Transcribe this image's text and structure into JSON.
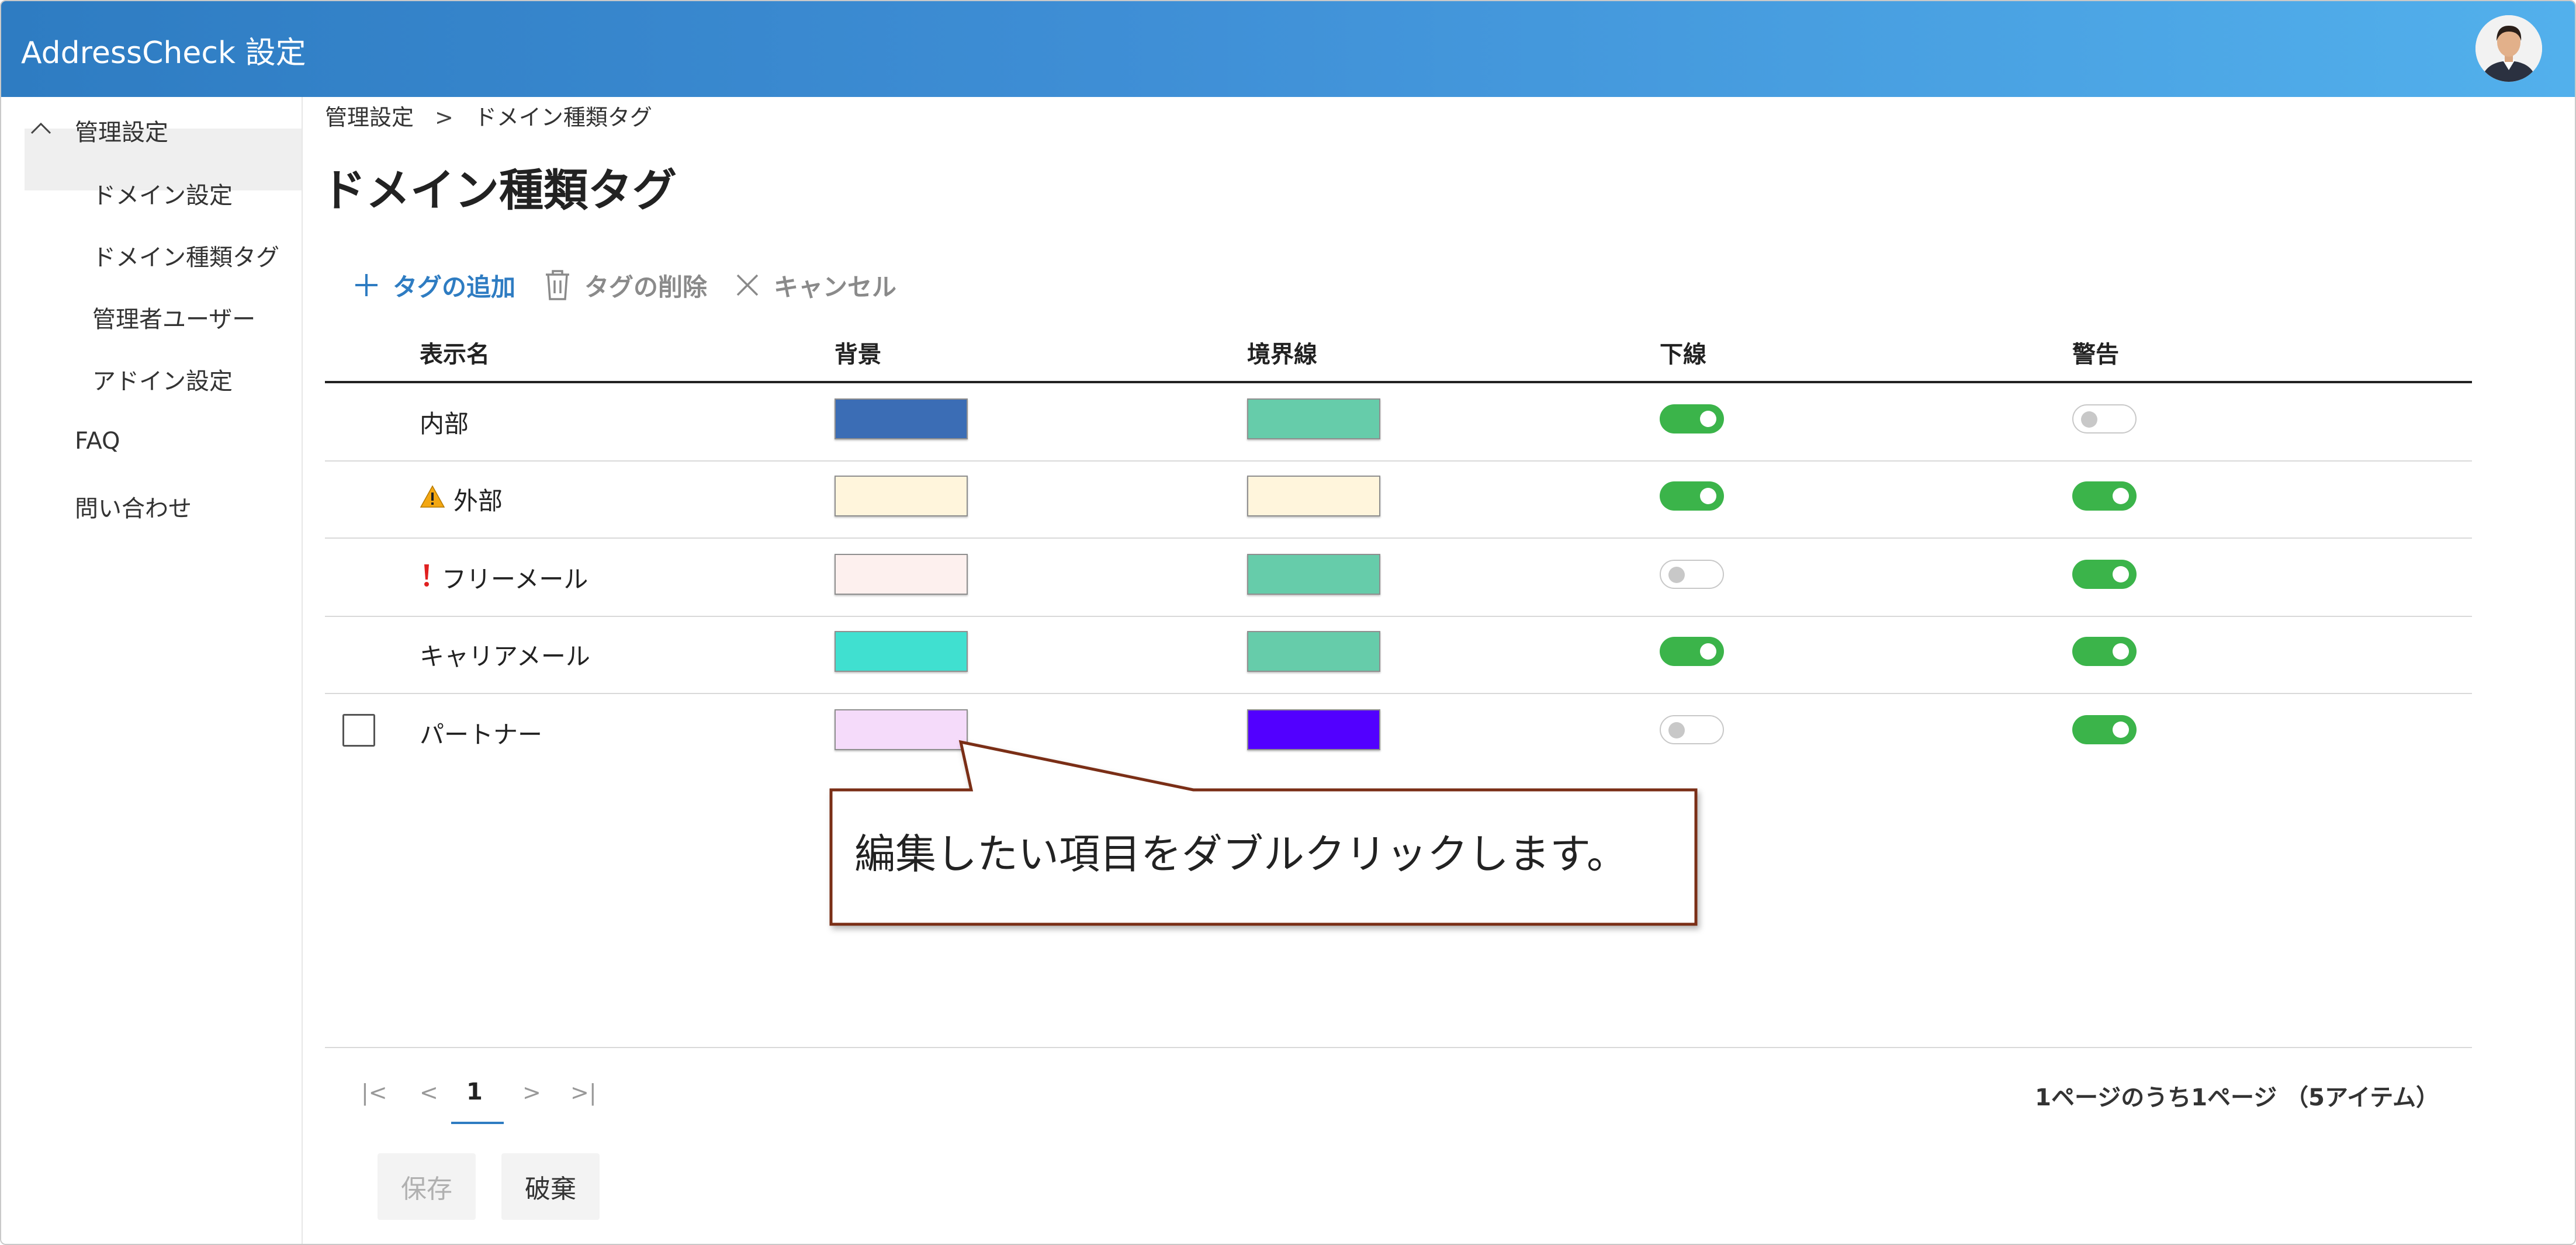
{
  "app": {
    "title": "AddressCheck 設定"
  },
  "sidebar": {
    "group_label": "管理設定",
    "items": [
      {
        "label": "ドメイン設定"
      },
      {
        "label": "ドメイン種類タグ",
        "selected": true
      },
      {
        "label": "管理者ユーザー"
      },
      {
        "label": "アドイン設定"
      }
    ],
    "faq": "FAQ",
    "contact": "問い合わせ"
  },
  "breadcrumb": {
    "parent": "管理設定",
    "separator": ">",
    "current": "ドメイン種類タグ"
  },
  "page": {
    "title": "ドメイン種類タグ"
  },
  "commands": {
    "add": "タグの追加",
    "delete": "タグの削除",
    "cancel": "キャンセル"
  },
  "table": {
    "columns": [
      "表示名",
      "背景",
      "境界線",
      "下線",
      "警告"
    ],
    "rows": [
      {
        "name": "内部",
        "icon": "",
        "background": "#3b6db5",
        "border": "#66ccaa",
        "underline": true,
        "warning": false
      },
      {
        "name": "外部",
        "icon": "warning-icon",
        "background": "#fff5dc",
        "border": "#fff5dc",
        "underline": true,
        "warning": true
      },
      {
        "name": "フリーメール",
        "icon": "exclamation-icon",
        "background": "#fdf0ee",
        "border": "#66ccaa",
        "underline": false,
        "warning": true
      },
      {
        "name": "キャリアメール",
        "icon": "",
        "background": "#40e0d0",
        "border": "#66ccaa",
        "underline": true,
        "warning": true
      },
      {
        "name": "パートナー",
        "icon": "",
        "background": "#f5dbfa",
        "border": "#5200ff",
        "underline": false,
        "warning": true
      }
    ]
  },
  "callout": {
    "text": "編集したい項目をダブルクリックします。"
  },
  "pagination": {
    "first": "|<",
    "prev": "<",
    "current": "1",
    "next": ">",
    "last": ">|",
    "info": "1ページのうち1ページ （5アイテム）"
  },
  "footer": {
    "save": "保存",
    "discard": "破棄"
  },
  "colors": {
    "accent": "#2e7cc2",
    "toggle_on": "#3bb44a",
    "callout_border": "#7a2e14"
  }
}
